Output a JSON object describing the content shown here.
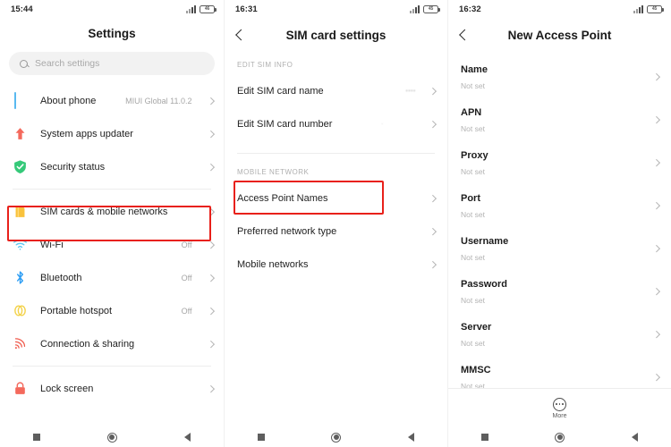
{
  "panels": [
    {
      "id": "settings",
      "status": {
        "time": "15:44",
        "battery_text": "46",
        "signal_icon": "signal-bars-icon",
        "battery_icon": "battery-icon"
      },
      "title": "Settings",
      "search": {
        "placeholder": "Search settings",
        "icon": "search-icon",
        "value": ""
      },
      "rows": [
        {
          "icon": "phone-icon",
          "label": "About phone",
          "value": "MIUI Global 11.0.2"
        },
        {
          "icon": "up-arrow-icon",
          "label": "System apps updater",
          "value": ""
        },
        {
          "icon": "shield-check-icon",
          "label": "Security status",
          "value": ""
        },
        {
          "icon": "sim-card-icon",
          "label": "SIM cards & mobile networks",
          "value": "",
          "highlighted": true
        },
        {
          "icon": "wifi-icon",
          "label": "Wi-Fi",
          "value": "Off"
        },
        {
          "icon": "bluetooth-icon",
          "label": "Bluetooth",
          "value": "Off"
        },
        {
          "icon": "hotspot-icon",
          "label": "Portable hotspot",
          "value": "Off"
        },
        {
          "icon": "connection-sharing-icon",
          "label": "Connection & sharing",
          "value": ""
        },
        {
          "icon": "lock-icon",
          "label": "Lock screen",
          "value": ""
        }
      ],
      "nav": {
        "recents": "recents-icon",
        "home": "home-icon",
        "back": "back-icon"
      }
    },
    {
      "id": "sim-card-settings",
      "status": {
        "time": "16:31",
        "battery_text": "45",
        "signal_icon": "signal-bars-icon",
        "battery_icon": "battery-icon"
      },
      "title": "SIM card settings",
      "back_icon": "back-chevron-icon",
      "sections": [
        {
          "header": "EDIT SIM INFO",
          "rows": [
            {
              "label": "Edit SIM card name",
              "value": "••••"
            },
            {
              "label": "Edit SIM card number",
              "value": "·"
            }
          ]
        },
        {
          "header": "MOBILE NETWORK",
          "rows": [
            {
              "label": "Access Point Names",
              "value": "",
              "highlighted": true
            },
            {
              "label": "Preferred network type",
              "value": ""
            },
            {
              "label": "Mobile networks",
              "value": ""
            }
          ]
        }
      ],
      "nav": {
        "recents": "recents-icon",
        "home": "home-icon",
        "back": "back-icon"
      }
    },
    {
      "id": "new-access-point",
      "status": {
        "time": "16:32",
        "battery_text": "45",
        "signal_icon": "signal-bars-icon",
        "battery_icon": "battery-icon"
      },
      "title": "New Access Point",
      "back_icon": "back-chevron-icon",
      "fields": [
        {
          "label": "Name",
          "value": "Not set"
        },
        {
          "label": "APN",
          "value": "Not set"
        },
        {
          "label": "Proxy",
          "value": "Not set"
        },
        {
          "label": "Port",
          "value": "Not set"
        },
        {
          "label": "Username",
          "value": "Not set"
        },
        {
          "label": "Password",
          "value": "Not set"
        },
        {
          "label": "Server",
          "value": "Not set"
        },
        {
          "label": "MMSC",
          "value": "Not set"
        }
      ],
      "more": {
        "label": "More",
        "icon": "more-dots-icon"
      },
      "nav": {
        "recents": "recents-icon",
        "home": "home-icon",
        "back": "back-icon"
      }
    }
  ],
  "colors": {
    "highlight": "#e8201a",
    "phone_icon": "#59b9f0",
    "arrow_icon": "#f4695c",
    "shield_icon": "#35c979",
    "sim_icon": "#f9c23c",
    "wifi_icon": "#5fc8f2",
    "bluetooth_icon": "#2f9ef4",
    "hotspot_icon": "#f3d24a",
    "share_icon": "#f05a4c",
    "lock_icon": "#f4695c"
  }
}
